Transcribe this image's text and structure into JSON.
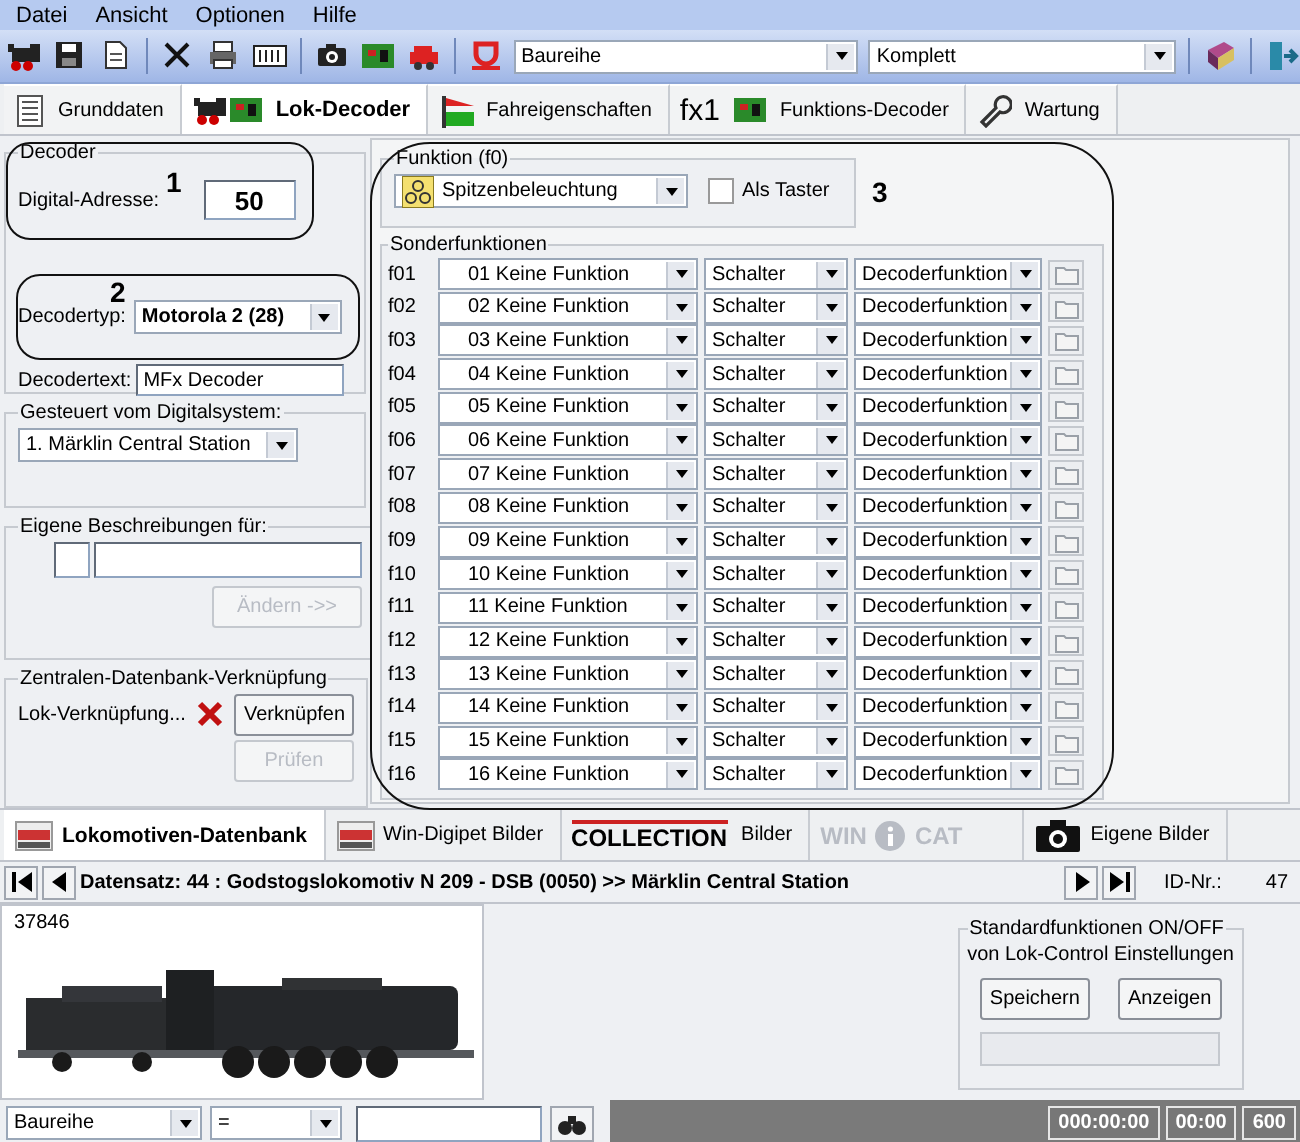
{
  "menu": [
    "Datei",
    "Ansicht",
    "Optionen",
    "Hilfe"
  ],
  "toolbar": {
    "series_combo": "Baureihe",
    "view_combo": "Komplett"
  },
  "tabs": [
    {
      "kind": "doc",
      "label": "Grunddaten",
      "selected": false
    },
    {
      "kind": "loco",
      "label": "Lok-Decoder",
      "selected": true
    },
    {
      "kind": "flag",
      "label": "Fahreigenschaften",
      "selected": false
    },
    {
      "kind": "fx",
      "prefix": "fx1",
      "label": "Funktions-Decoder",
      "selected": false
    },
    {
      "kind": "wrench",
      "label": "Wartung",
      "selected": false
    }
  ],
  "annotations": [
    "1",
    "2",
    "3"
  ],
  "decoder": {
    "title": "Decoder",
    "address_label": "Digital-Adresse:",
    "address": "50",
    "type_label": "Decodertyp:",
    "type": "Motorola 2 (28)",
    "text_label": "Decodertext:",
    "text": "MFx Decoder"
  },
  "digital_system": {
    "title": "Gesteuert vom Digitalsystem:",
    "value": "1. Märklin Central Station"
  },
  "own_descriptions": {
    "title": "Eigene Beschreibungen für:",
    "button": "Ändern ->>",
    "button_disabled": true
  },
  "central_db": {
    "title": "Zentralen-Datenbank-Verknüpfung",
    "label": "Lok-Verknüpfung...",
    "linked": false,
    "buttons": [
      {
        "label": "Verknüpfen",
        "disabled": false
      },
      {
        "label": "Prüfen",
        "disabled": true
      }
    ]
  },
  "function_f0": {
    "title": "Funktion (f0)",
    "value": "Spitzenbeleuchtung",
    "push_label": "Als Taster",
    "push_checked": false
  },
  "special_functions": {
    "title": "Sonderfunktionen",
    "rows": [
      {
        "key": "f01",
        "function": "01 Keine Funktion",
        "mode": "Schalter",
        "source": "Decoderfunktion"
      },
      {
        "key": "f02",
        "function": "02 Keine Funktion",
        "mode": "Schalter",
        "source": "Decoderfunktion"
      },
      {
        "key": "f03",
        "function": "03 Keine Funktion",
        "mode": "Schalter",
        "source": "Decoderfunktion"
      },
      {
        "key": "f04",
        "function": "04 Keine Funktion",
        "mode": "Schalter",
        "source": "Decoderfunktion"
      },
      {
        "key": "f05",
        "function": "05 Keine Funktion",
        "mode": "Schalter",
        "source": "Decoderfunktion"
      },
      {
        "key": "f06",
        "function": "06 Keine Funktion",
        "mode": "Schalter",
        "source": "Decoderfunktion"
      },
      {
        "key": "f07",
        "function": "07 Keine Funktion",
        "mode": "Schalter",
        "source": "Decoderfunktion"
      },
      {
        "key": "f08",
        "function": "08 Keine Funktion",
        "mode": "Schalter",
        "source": "Decoderfunktion"
      },
      {
        "key": "f09",
        "function": "09 Keine Funktion",
        "mode": "Schalter",
        "source": "Decoderfunktion"
      },
      {
        "key": "f10",
        "function": "10 Keine Funktion",
        "mode": "Schalter",
        "source": "Decoderfunktion"
      },
      {
        "key": "f11",
        "function": "11 Keine Funktion",
        "mode": "Schalter",
        "source": "Decoderfunktion"
      },
      {
        "key": "f12",
        "function": "12 Keine Funktion",
        "mode": "Schalter",
        "source": "Decoderfunktion"
      },
      {
        "key": "f13",
        "function": "13 Keine Funktion",
        "mode": "Schalter",
        "source": "Decoderfunktion"
      },
      {
        "key": "f14",
        "function": "14 Keine Funktion",
        "mode": "Schalter",
        "source": "Decoderfunktion"
      },
      {
        "key": "f15",
        "function": "15 Keine Funktion",
        "mode": "Schalter",
        "source": "Decoderfunktion"
      },
      {
        "key": "f16",
        "function": "16 Keine Funktion",
        "mode": "Schalter",
        "source": "Decoderfunktion"
      }
    ]
  },
  "bottom_tabs": [
    {
      "kind": "wdp",
      "label": "Lokomotiven-Datenbank",
      "selected": true,
      "disabled": false
    },
    {
      "kind": "wdp",
      "label": "Win-Digipet Bilder",
      "selected": false,
      "disabled": false
    },
    {
      "kind": "collection",
      "logo": "COLLECTION",
      "label": "Bilder",
      "selected": false,
      "disabled": false
    },
    {
      "kind": "wincat",
      "logo": "WIN",
      "logo_2": "CAT",
      "selected": false,
      "disabled": true
    },
    {
      "kind": "camera",
      "label": "Eigene Bilder",
      "selected": false,
      "disabled": false
    }
  ],
  "record_nav": {
    "text": "Datensatz: 44 : Godstogslokomotiv N 209 - DSB  (0050) >> Märklin Central Station",
    "id_label": "ID-Nr.:",
    "id": "47"
  },
  "preview": {
    "caption": "37846"
  },
  "standard_functions": {
    "title": "Standardfunktionen ON/OFF",
    "subtitle": "von Lok-Control Einstellungen",
    "buttons": [
      "Speichern",
      "Anzeigen"
    ]
  },
  "status_bar": {
    "filter_field": "Baureihe",
    "operator": "=",
    "times": [
      "000:00:00",
      "00:00",
      "600"
    ]
  }
}
